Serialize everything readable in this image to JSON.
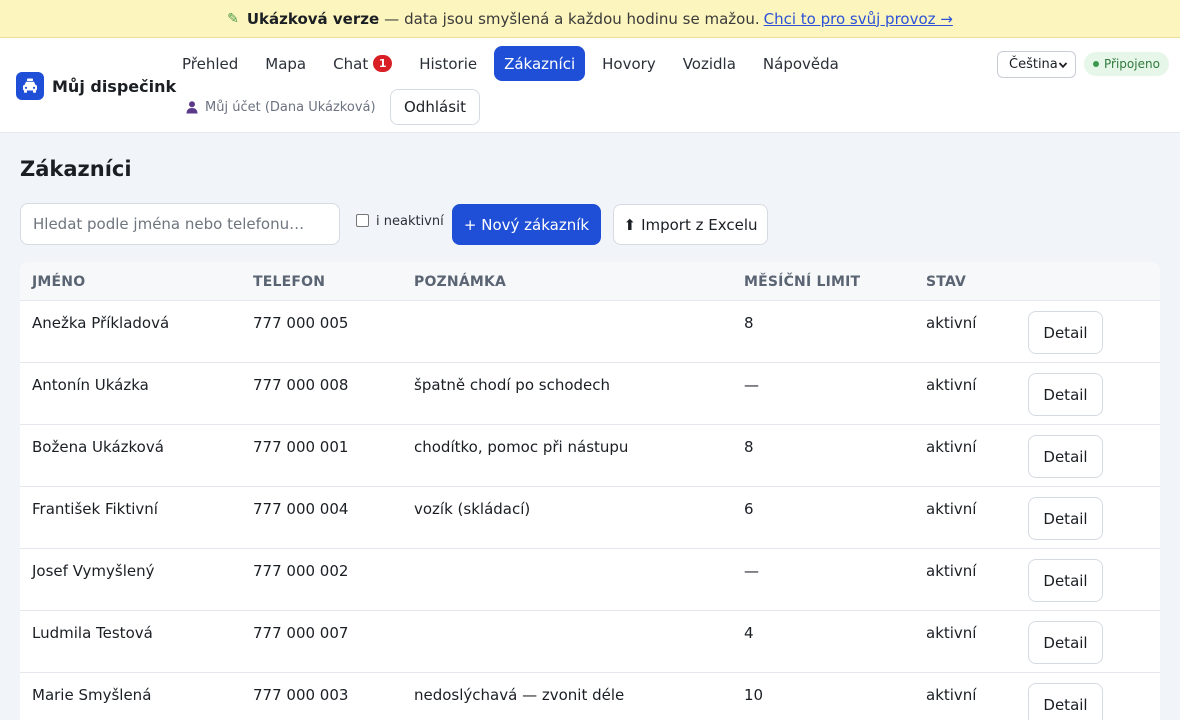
{
  "banner": {
    "title": "Ukázková verze",
    "separator": "—",
    "text": "data jsou smyšlená a každou hodinu se mažou.",
    "link": "Chci to pro svůj provoz →"
  },
  "brand": {
    "name": "Můj dispečink"
  },
  "nav": {
    "items": [
      {
        "label": "Přehled",
        "active": false
      },
      {
        "label": "Mapa",
        "active": false
      },
      {
        "label": "Chat",
        "active": false,
        "badge": "1"
      },
      {
        "label": "Historie",
        "active": false
      },
      {
        "label": "Zákazníci",
        "active": true
      },
      {
        "label": "Hovory",
        "active": false
      },
      {
        "label": "Vozidla",
        "active": false
      },
      {
        "label": "Nápověda",
        "active": false
      }
    ]
  },
  "account": {
    "label": "Můj účet (Dana Ukázková)",
    "logout": "Odhlásit"
  },
  "language": {
    "selected": "Čeština"
  },
  "connection": {
    "status": "Připojeno"
  },
  "page": {
    "title": "Zákazníci"
  },
  "toolbar": {
    "search_placeholder": "Hledat podle jména nebo telefonu…",
    "inactive_label": "i neaktivní",
    "new_customer": "+ Nový zákazník",
    "import_label": "Import z Excelu"
  },
  "table": {
    "columns": [
      "JMÉNO",
      "TELEFON",
      "POZNÁMKA",
      "MĚSÍČNÍ LIMIT",
      "STAV"
    ],
    "detail_label": "Detail",
    "rows": [
      {
        "name": "Anežka Příkladová",
        "phone": "777 000 005",
        "note": "",
        "limit": "8",
        "status": "aktivní"
      },
      {
        "name": "Antonín Ukázka",
        "phone": "777 000 008",
        "note": "špatně chodí po schodech",
        "limit": "—",
        "status": "aktivní"
      },
      {
        "name": "Božena Ukázková",
        "phone": "777 000 001",
        "note": "chodítko, pomoc při nástupu",
        "limit": "8",
        "status": "aktivní"
      },
      {
        "name": "František Fiktivní",
        "phone": "777 000 004",
        "note": "vozík (skládací)",
        "limit": "6",
        "status": "aktivní"
      },
      {
        "name": "Josef Vymyšlený",
        "phone": "777 000 002",
        "note": "",
        "limit": "—",
        "status": "aktivní"
      },
      {
        "name": "Ludmila Testová",
        "phone": "777 000 007",
        "note": "",
        "limit": "4",
        "status": "aktivní"
      },
      {
        "name": "Marie Smyšlená",
        "phone": "777 000 003",
        "note": "nedoslýchavá — zvonit déle",
        "limit": "10",
        "status": "aktivní"
      }
    ]
  },
  "colors": {
    "accent": "#1f4fd6",
    "banner_bg": "#fcf5bd",
    "badge": "#d81f26",
    "connected": "#2f7a3c"
  }
}
